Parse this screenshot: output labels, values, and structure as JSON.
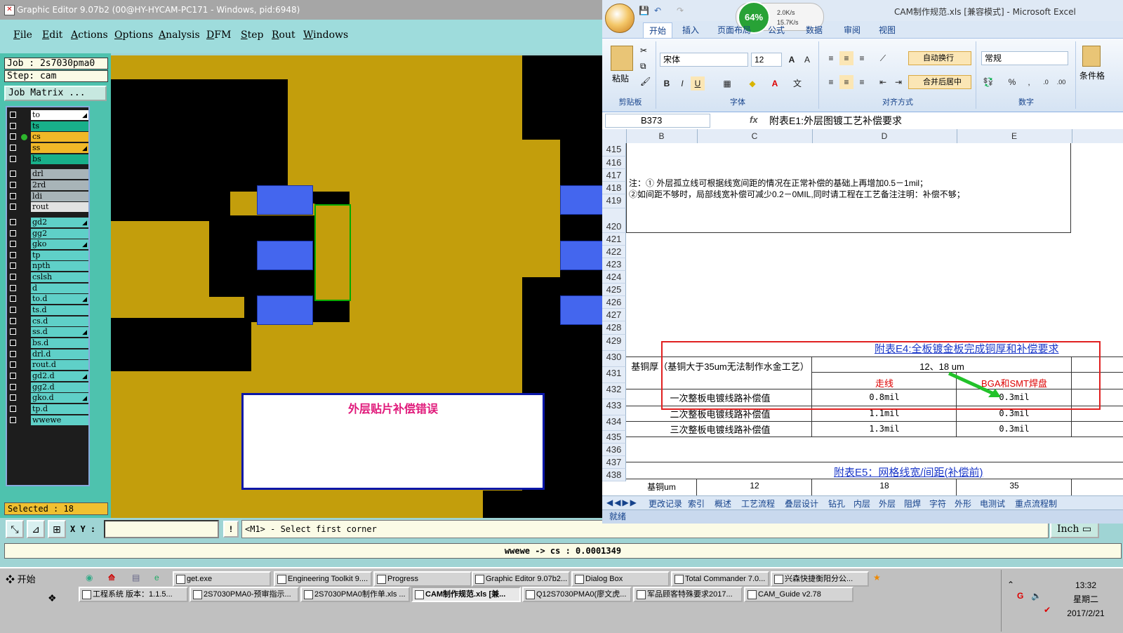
{
  "genesis": {
    "title": "Graphic Editor 9.07b2 (00@HY-HYCAM-PC171 - Windows, pid:6948)",
    "menu": [
      "File",
      "Edit",
      "Actions",
      "Options",
      "Analysis",
      "DFM",
      "Step",
      "Rout",
      "Windows"
    ],
    "job_label": "Job : 2s7030pma0",
    "step_label": "Step: cam",
    "job_matrix_label": "Job Matrix ...",
    "layers": [
      {
        "name": "to",
        "color": "#ffffff",
        "arrow": true
      },
      {
        "name": "ts",
        "color": "#18b08a",
        "arrow": false
      },
      {
        "name": "cs",
        "color": "#f0b828",
        "arrow": false,
        "active": true
      },
      {
        "name": "ss",
        "color": "#f0b828",
        "arrow": true
      },
      {
        "name": "bs",
        "color": "#18b08a",
        "arrow": false
      },
      {
        "name": "drl",
        "color": "#a8b4b8",
        "arrow": false
      },
      {
        "name": "2rd",
        "color": "#a8b4b8",
        "arrow": false
      },
      {
        "name": "ldi",
        "color": "#a8b4b8",
        "arrow": false
      },
      {
        "name": "rout",
        "color": "#e2e2e2",
        "arrow": false
      },
      {
        "name": "gd2",
        "color": "#5fd0c8",
        "arrow": true
      },
      {
        "name": "gg2",
        "color": "#5fd0c8",
        "arrow": false
      },
      {
        "name": "gko",
        "color": "#5fd0c8",
        "arrow": true
      },
      {
        "name": "tp",
        "color": "#5fd0c8",
        "arrow": false
      },
      {
        "name": "npth",
        "color": "#5fd0c8",
        "arrow": false
      },
      {
        "name": "cslsh",
        "color": "#5fd0c8",
        "arrow": false
      },
      {
        "name": "d",
        "color": "#5fd0c8",
        "arrow": false
      },
      {
        "name": "to.d",
        "color": "#5fd0c8",
        "arrow": true
      },
      {
        "name": "ts.d",
        "color": "#5fd0c8",
        "arrow": false
      },
      {
        "name": "cs.d",
        "color": "#5fd0c8",
        "arrow": false
      },
      {
        "name": "ss.d",
        "color": "#5fd0c8",
        "arrow": true
      },
      {
        "name": "bs.d",
        "color": "#5fd0c8",
        "arrow": false
      },
      {
        "name": "drl.d",
        "color": "#5fd0c8",
        "arrow": false
      },
      {
        "name": "rout.d",
        "color": "#5fd0c8",
        "arrow": false
      },
      {
        "name": "gd2.d",
        "color": "#5fd0c8",
        "arrow": true
      },
      {
        "name": "gg2.d",
        "color": "#5fd0c8",
        "arrow": false
      },
      {
        "name": "gko.d",
        "color": "#5fd0c8",
        "arrow": true
      },
      {
        "name": "tp.d",
        "color": "#5fd0c8",
        "arrow": false
      },
      {
        "name": "wwewe",
        "color": "#5fd0c8",
        "arrow": false
      }
    ],
    "selected_label": "Selected : 18",
    "annotation_text": "外层贴片补偿错误",
    "xy_label": "X Y :",
    "xy_value": "",
    "prompt": "<M1> - Select first corner",
    "units": "Inch",
    "measure": "wwewe -> cs : 0.0001349",
    "colors": {
      "copper": "#c39e0c",
      "pad": "#4466ee",
      "panel": "#4ec2ae"
    }
  },
  "excel": {
    "title": "CAM制作规范.xls  [兼容模式] - Microsoft Excel",
    "net_percent": "64%",
    "net_up": "2.0K/s",
    "net_down": "15.7K/s",
    "tabs": [
      "开始",
      "插入",
      "页面布局",
      "公式",
      "数据",
      "审阅",
      "视图"
    ],
    "ribbon": {
      "paste": "粘贴",
      "font_name": "宋体",
      "font_size": "12",
      "wrap_text": "自动换行",
      "merge_center": "合并后居中",
      "number_format": "常规",
      "cond_format": "条件格",
      "groups": [
        "剪贴板",
        "字体",
        "对齐方式",
        "数字"
      ]
    },
    "name_box": "B373",
    "fx": "fx",
    "formula": "附表E1:外层图镀工艺补偿要求",
    "columns": [
      "B",
      "C",
      "D",
      "E"
    ],
    "rows": [
      "415",
      "416",
      "417",
      "418",
      "419",
      "420",
      "421",
      "422",
      "423",
      "424",
      "425",
      "426",
      "427",
      "428",
      "429",
      "430",
      "431",
      "432",
      "433",
      "434",
      "435",
      "436",
      "437",
      "438"
    ],
    "note1": "注：① 外层孤立线可根据线宽间距的情况在正常补偿的基础上再增加0.5－1mil；",
    "note2": "②如间距不够时，局部线宽补偿可减少0.2－0MIL,同时请工程在工艺备注注明：补偿不够；",
    "e4_title": "附表E4:全板镀金板完成铜厚和补偿要求",
    "base_copper": "基铜厚（基铜大于35um无法制作水金工艺）",
    "thickness": "12、18 um",
    "trace": "走线",
    "bga": "BGA和SMT焊盘",
    "comp_rows": [
      {
        "label": "一次整板电镀线路补偿值",
        "trace": "0.8mil",
        "bga": "0.3mil"
      },
      {
        "label": "二次整板电镀线路补偿值",
        "trace": "1.1mil",
        "bga": "0.3mil"
      },
      {
        "label": "三次整板电镀线路补偿值",
        "trace": "1.3mil",
        "bga": "0.3mil"
      }
    ],
    "e5_title": "附表E5：网格线宽/间距(补偿前)",
    "e5_header": [
      "基铜um",
      "12",
      "18",
      "35"
    ],
    "sheet_tabs": [
      "更改记录",
      "索引",
      "概述",
      "工艺流程",
      "叠层设计",
      "钻孔",
      "内层",
      "外层",
      "阻焊",
      "字符",
      "外形",
      "电测试",
      "重点流程制"
    ],
    "status": "就绪"
  },
  "taskbar": {
    "start": "开始",
    "row1": [
      "get.exe",
      "Engineering Toolkit 9....",
      "Progress",
      "Graphic Editor 9.07b2...",
      "Dialog Box",
      "Total Commander 7.0...",
      "兴森快捷衡阳分公..."
    ],
    "row2": [
      "工程系统  版本：1.1.5...",
      "2S7030PMA0-预审指示...",
      "2S7030PMA0制作单.xls ...",
      "CAM制作规范.xls [兼...",
      "Q12S7030PMA0(廖文虎...",
      "军品顾客特殊要求2017...",
      "CAM_Guide v2.78"
    ],
    "time": "13:32",
    "weekday": "星期二",
    "date": "2017/2/21"
  }
}
